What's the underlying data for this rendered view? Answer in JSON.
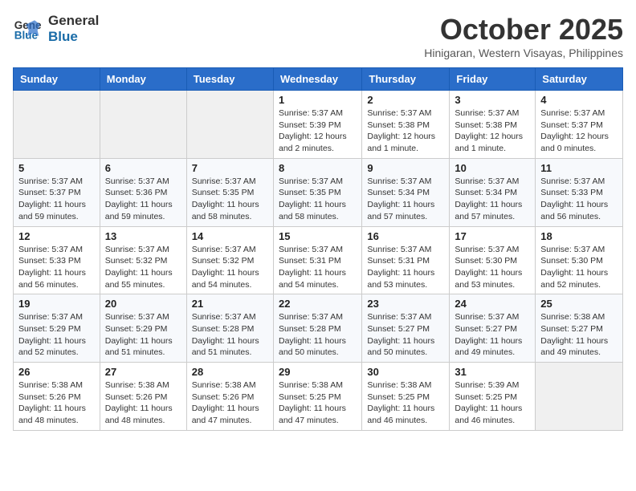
{
  "header": {
    "logo_line1": "General",
    "logo_line2": "Blue",
    "month_title": "October 2025",
    "location": "Hinigaran, Western Visayas, Philippines"
  },
  "days_of_week": [
    "Sunday",
    "Monday",
    "Tuesday",
    "Wednesday",
    "Thursday",
    "Friday",
    "Saturday"
  ],
  "weeks": [
    [
      {
        "day": "",
        "empty": true
      },
      {
        "day": "",
        "empty": true
      },
      {
        "day": "",
        "empty": true
      },
      {
        "day": "1",
        "sunrise": "5:37 AM",
        "sunset": "5:39 PM",
        "daylight": "12 hours and 2 minutes."
      },
      {
        "day": "2",
        "sunrise": "5:37 AM",
        "sunset": "5:38 PM",
        "daylight": "12 hours and 1 minute."
      },
      {
        "day": "3",
        "sunrise": "5:37 AM",
        "sunset": "5:38 PM",
        "daylight": "12 hours and 1 minute."
      },
      {
        "day": "4",
        "sunrise": "5:37 AM",
        "sunset": "5:37 PM",
        "daylight": "12 hours and 0 minutes."
      }
    ],
    [
      {
        "day": "5",
        "sunrise": "5:37 AM",
        "sunset": "5:37 PM",
        "daylight": "11 hours and 59 minutes."
      },
      {
        "day": "6",
        "sunrise": "5:37 AM",
        "sunset": "5:36 PM",
        "daylight": "11 hours and 59 minutes."
      },
      {
        "day": "7",
        "sunrise": "5:37 AM",
        "sunset": "5:35 PM",
        "daylight": "11 hours and 58 minutes."
      },
      {
        "day": "8",
        "sunrise": "5:37 AM",
        "sunset": "5:35 PM",
        "daylight": "11 hours and 58 minutes."
      },
      {
        "day": "9",
        "sunrise": "5:37 AM",
        "sunset": "5:34 PM",
        "daylight": "11 hours and 57 minutes."
      },
      {
        "day": "10",
        "sunrise": "5:37 AM",
        "sunset": "5:34 PM",
        "daylight": "11 hours and 57 minutes."
      },
      {
        "day": "11",
        "sunrise": "5:37 AM",
        "sunset": "5:33 PM",
        "daylight": "11 hours and 56 minutes."
      }
    ],
    [
      {
        "day": "12",
        "sunrise": "5:37 AM",
        "sunset": "5:33 PM",
        "daylight": "11 hours and 56 minutes."
      },
      {
        "day": "13",
        "sunrise": "5:37 AM",
        "sunset": "5:32 PM",
        "daylight": "11 hours and 55 minutes."
      },
      {
        "day": "14",
        "sunrise": "5:37 AM",
        "sunset": "5:32 PM",
        "daylight": "11 hours and 54 minutes."
      },
      {
        "day": "15",
        "sunrise": "5:37 AM",
        "sunset": "5:31 PM",
        "daylight": "11 hours and 54 minutes."
      },
      {
        "day": "16",
        "sunrise": "5:37 AM",
        "sunset": "5:31 PM",
        "daylight": "11 hours and 53 minutes."
      },
      {
        "day": "17",
        "sunrise": "5:37 AM",
        "sunset": "5:30 PM",
        "daylight": "11 hours and 53 minutes."
      },
      {
        "day": "18",
        "sunrise": "5:37 AM",
        "sunset": "5:30 PM",
        "daylight": "11 hours and 52 minutes."
      }
    ],
    [
      {
        "day": "19",
        "sunrise": "5:37 AM",
        "sunset": "5:29 PM",
        "daylight": "11 hours and 52 minutes."
      },
      {
        "day": "20",
        "sunrise": "5:37 AM",
        "sunset": "5:29 PM",
        "daylight": "11 hours and 51 minutes."
      },
      {
        "day": "21",
        "sunrise": "5:37 AM",
        "sunset": "5:28 PM",
        "daylight": "11 hours and 51 minutes."
      },
      {
        "day": "22",
        "sunrise": "5:37 AM",
        "sunset": "5:28 PM",
        "daylight": "11 hours and 50 minutes."
      },
      {
        "day": "23",
        "sunrise": "5:37 AM",
        "sunset": "5:27 PM",
        "daylight": "11 hours and 50 minutes."
      },
      {
        "day": "24",
        "sunrise": "5:37 AM",
        "sunset": "5:27 PM",
        "daylight": "11 hours and 49 minutes."
      },
      {
        "day": "25",
        "sunrise": "5:38 AM",
        "sunset": "5:27 PM",
        "daylight": "11 hours and 49 minutes."
      }
    ],
    [
      {
        "day": "26",
        "sunrise": "5:38 AM",
        "sunset": "5:26 PM",
        "daylight": "11 hours and 48 minutes."
      },
      {
        "day": "27",
        "sunrise": "5:38 AM",
        "sunset": "5:26 PM",
        "daylight": "11 hours and 48 minutes."
      },
      {
        "day": "28",
        "sunrise": "5:38 AM",
        "sunset": "5:26 PM",
        "daylight": "11 hours and 47 minutes."
      },
      {
        "day": "29",
        "sunrise": "5:38 AM",
        "sunset": "5:25 PM",
        "daylight": "11 hours and 47 minutes."
      },
      {
        "day": "30",
        "sunrise": "5:38 AM",
        "sunset": "5:25 PM",
        "daylight": "11 hours and 46 minutes."
      },
      {
        "day": "31",
        "sunrise": "5:39 AM",
        "sunset": "5:25 PM",
        "daylight": "11 hours and 46 minutes."
      },
      {
        "day": "",
        "empty": true
      }
    ]
  ]
}
